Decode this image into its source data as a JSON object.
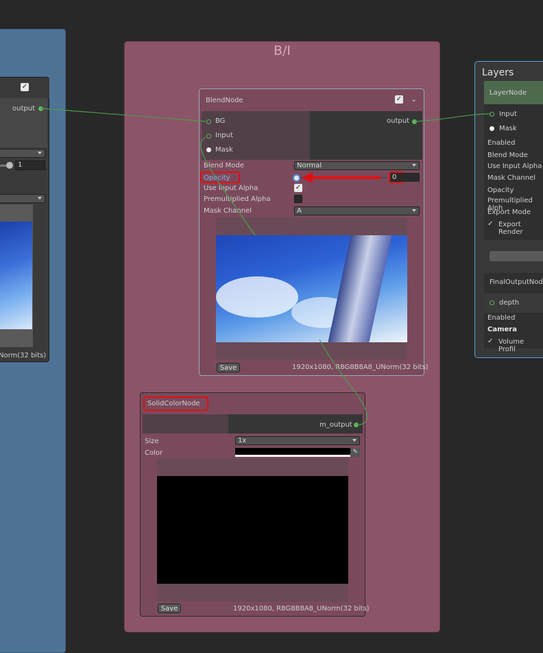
{
  "group": {
    "title": "B/I"
  },
  "left_node": {
    "output_label": "output",
    "value_field": "1",
    "info": "Norm(32 bits)"
  },
  "blend_node": {
    "title": "BlendNode",
    "inputs": [
      "BG",
      "Input",
      "Mask"
    ],
    "output_label": "output",
    "props": {
      "blend_mode_label": "Blend Mode",
      "blend_mode_value": "Normal",
      "opacity_label": "Opacity",
      "opacity_value": "0",
      "use_input_alpha_label": "Use Input Alpha",
      "premultiplied_alpha_label": "Premultiplied Alpha",
      "mask_channel_label": "Mask Channel",
      "mask_channel_value": "A"
    },
    "save_label": "Save",
    "info": "1920x1080, R8G8B8A8_UNorm(32 bits)"
  },
  "solid_node": {
    "title": "SolidColorNode",
    "output_label": "m_output",
    "size_label": "Size",
    "size_value": "1x",
    "color_label": "Color",
    "save_label": "Save",
    "info": "1920x1080, R8G8B8A8_UNorm(32 bits)"
  },
  "layers_panel": {
    "title": "Layers",
    "layer_node_title": "LayerNode",
    "inputs": [
      "Input",
      "Mask"
    ],
    "props": [
      "Enabled",
      "Blend Mode",
      "Use Input Alpha",
      "Mask Channel",
      "Opacity",
      "Premultiplied Alph",
      "Export Mode"
    ],
    "export_render_label": "Export Render",
    "final_node_title": "FinalOutputNod",
    "depth_label": "depth",
    "enabled_label": "Enabled",
    "camera_label": "Camera",
    "volume_label": "Volume Profil"
  },
  "colors": {
    "group_bg": "#8c5468",
    "left_group_bg": "#4f7396",
    "edge": "#5eb55e",
    "highlight": "#e01010",
    "panel_border": "#52a7d8"
  }
}
